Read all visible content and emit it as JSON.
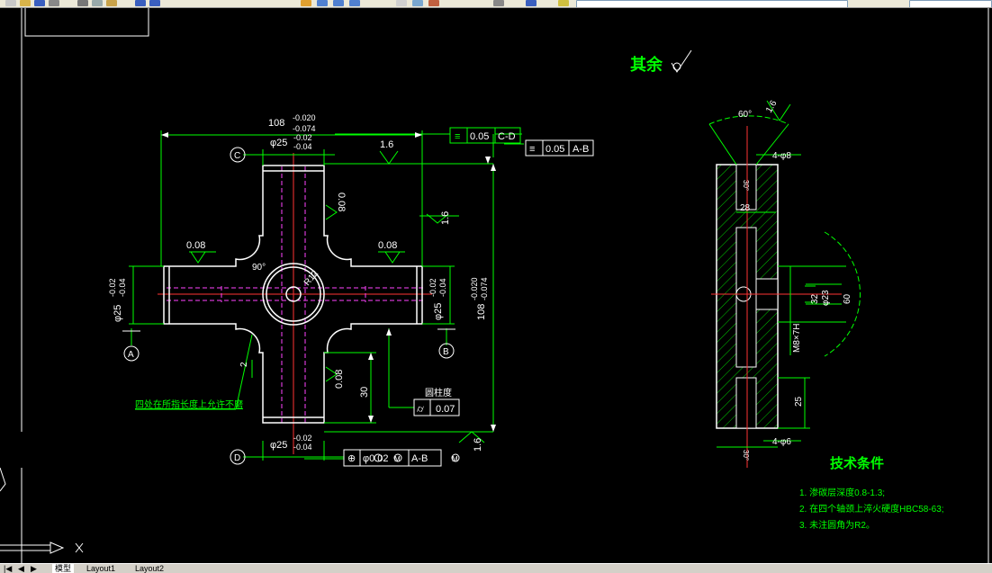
{
  "colors": {
    "green": "#00ff00",
    "white": "#ffffff",
    "red": "#ff3333",
    "magenta": "#ff44ff",
    "yellow": "#ffff00",
    "cad_bg": "#000000"
  },
  "drawing": {
    "roughness_other": "其余",
    "dim_overall_top": "108",
    "dim_overall_top_tol_upper": "-0.020",
    "dim_overall_top_tol_lower": "-0.074",
    "dim_phi25_top": "φ25",
    "dim_phi25_top_tol_upper": "-0.02",
    "dim_phi25_top_tol_lower": "-0.04",
    "dim_phi25_bottom": "φ25",
    "dim_phi25_bottom_tol_upper": "-0.02",
    "dim_phi25_bottom_tol_lower": "-0.04",
    "dim_phi25_left": "φ25",
    "dim_phi25_left_tol_upper": "-0.02",
    "dim_phi25_left_tol_lower": "-0.04",
    "dim_phi25_right": "φ25",
    "dim_phi25_right_tol_upper": "-0.02",
    "dim_phi25_right_tol_lower": "-0.04",
    "dim_overall_right": "108",
    "dim_overall_right_tol_upper": "-0.020",
    "dim_overall_right_tol_lower": "-0.074",
    "rough_1_6_a": "1.6",
    "rough_1_6_b": "1.6",
    "rough_1_6_c": "1.6",
    "rough_0_08_a": "0.08",
    "rough_0_08_b": "0.08",
    "rough_0_08_c": "0.08",
    "rough_0_08_d": "0.08",
    "tol_sym_1_value": "0.05",
    "tol_sym_1_datum": "C-D",
    "tol_sym_2_value": "0.05",
    "tol_sym_2_datum": "A-B",
    "tol_pos_value": "φ0.02",
    "tol_pos_mod": "M",
    "tol_pos_datum": "A-B",
    "tol_pos_datum_mod": "M",
    "tol_cyl_label": "圆柱度",
    "tol_cyl_value": "0.07",
    "datum_a": "A",
    "datum_b": "B",
    "datum_c": "C",
    "datum_d": "D",
    "angle_90": "90°",
    "radius_r12": "R12",
    "dim_2": "2",
    "dim_30": "30",
    "note_green": "四处在所指长度上允许不磨",
    "side_angle_60": "60°",
    "side_rough_16": "1.6",
    "side_hole_4_phi8": "4-φ8",
    "side_dim_28": "28",
    "side_dim_32": "32",
    "side_dim_23": "φ23",
    "side_dim_60": "60",
    "side_thread": "M8×7H",
    "side_dim_25": "25",
    "side_hole_4_phi6": "4-φ6",
    "side_dim_30_top": "30°",
    "side_dim_30_bottom": "30°",
    "tech_title": "技术条件",
    "tech_items": [
      "1. 渗碳层深度0.8-1.3;",
      "2. 在四个轴颈上淬火硬度HBC58-63;",
      "3. 未注圆角为R2。"
    ]
  },
  "tabs": [
    {
      "label": "模型"
    },
    {
      "label": "Layout1"
    },
    {
      "label": "Layout2"
    }
  ]
}
